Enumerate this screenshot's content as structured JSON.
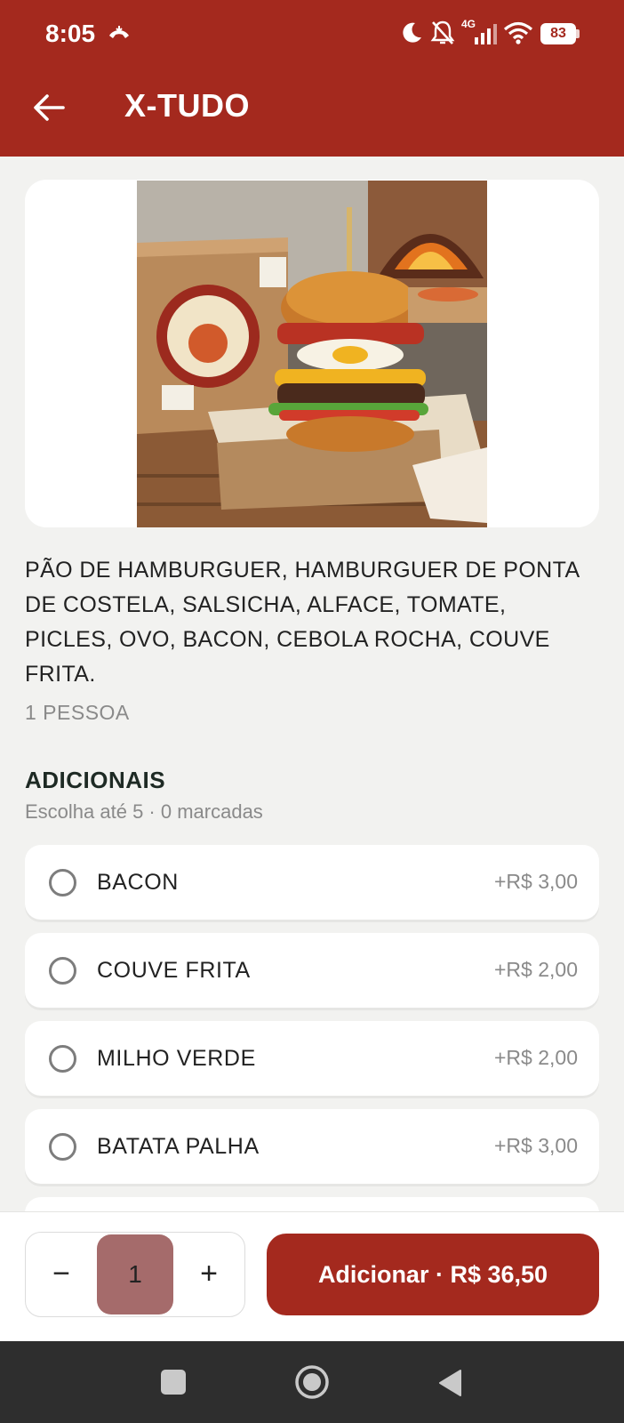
{
  "status_bar": {
    "time": "8:05",
    "network": "4G",
    "battery": "83",
    "icons": [
      "call-icon",
      "moon-icon",
      "bell-off-icon",
      "signal-icon",
      "wifi-icon",
      "battery-icon"
    ]
  },
  "header": {
    "title": "X-TUDO",
    "back_icon": "arrow-left-icon",
    "background": "#a4291e"
  },
  "product": {
    "image_alt": "X-Tudo burger",
    "description": "PÃO DE HAMBURGUER, HAMBURGUER DE PONTA DE COSTELA, SALSICHA, ALFACE, TOMATE, PICLES,  OVO, BACON, CEBOLA ROCHA, COUVE FRITA.",
    "serves": "1 PESSOA"
  },
  "addons": {
    "title": "ADICIONAIS",
    "subtitle": "Escolha até 5 · 0 marcadas",
    "items": [
      {
        "label": "BACON",
        "price": "+R$ 3,00"
      },
      {
        "label": "COUVE FRITA",
        "price": "+R$ 2,00"
      },
      {
        "label": "MILHO VERDE",
        "price": "+R$ 2,00"
      },
      {
        "label": "BATATA PALHA",
        "price": "+R$ 3,00"
      }
    ]
  },
  "cart": {
    "minus": "−",
    "quantity": "1",
    "plus": "+",
    "add_label": "Adicionar · R$ 36,50"
  },
  "colors": {
    "primary": "#a4291e",
    "quantity_bg": "#a56b6b",
    "muted_text": "#8a8a8a"
  }
}
